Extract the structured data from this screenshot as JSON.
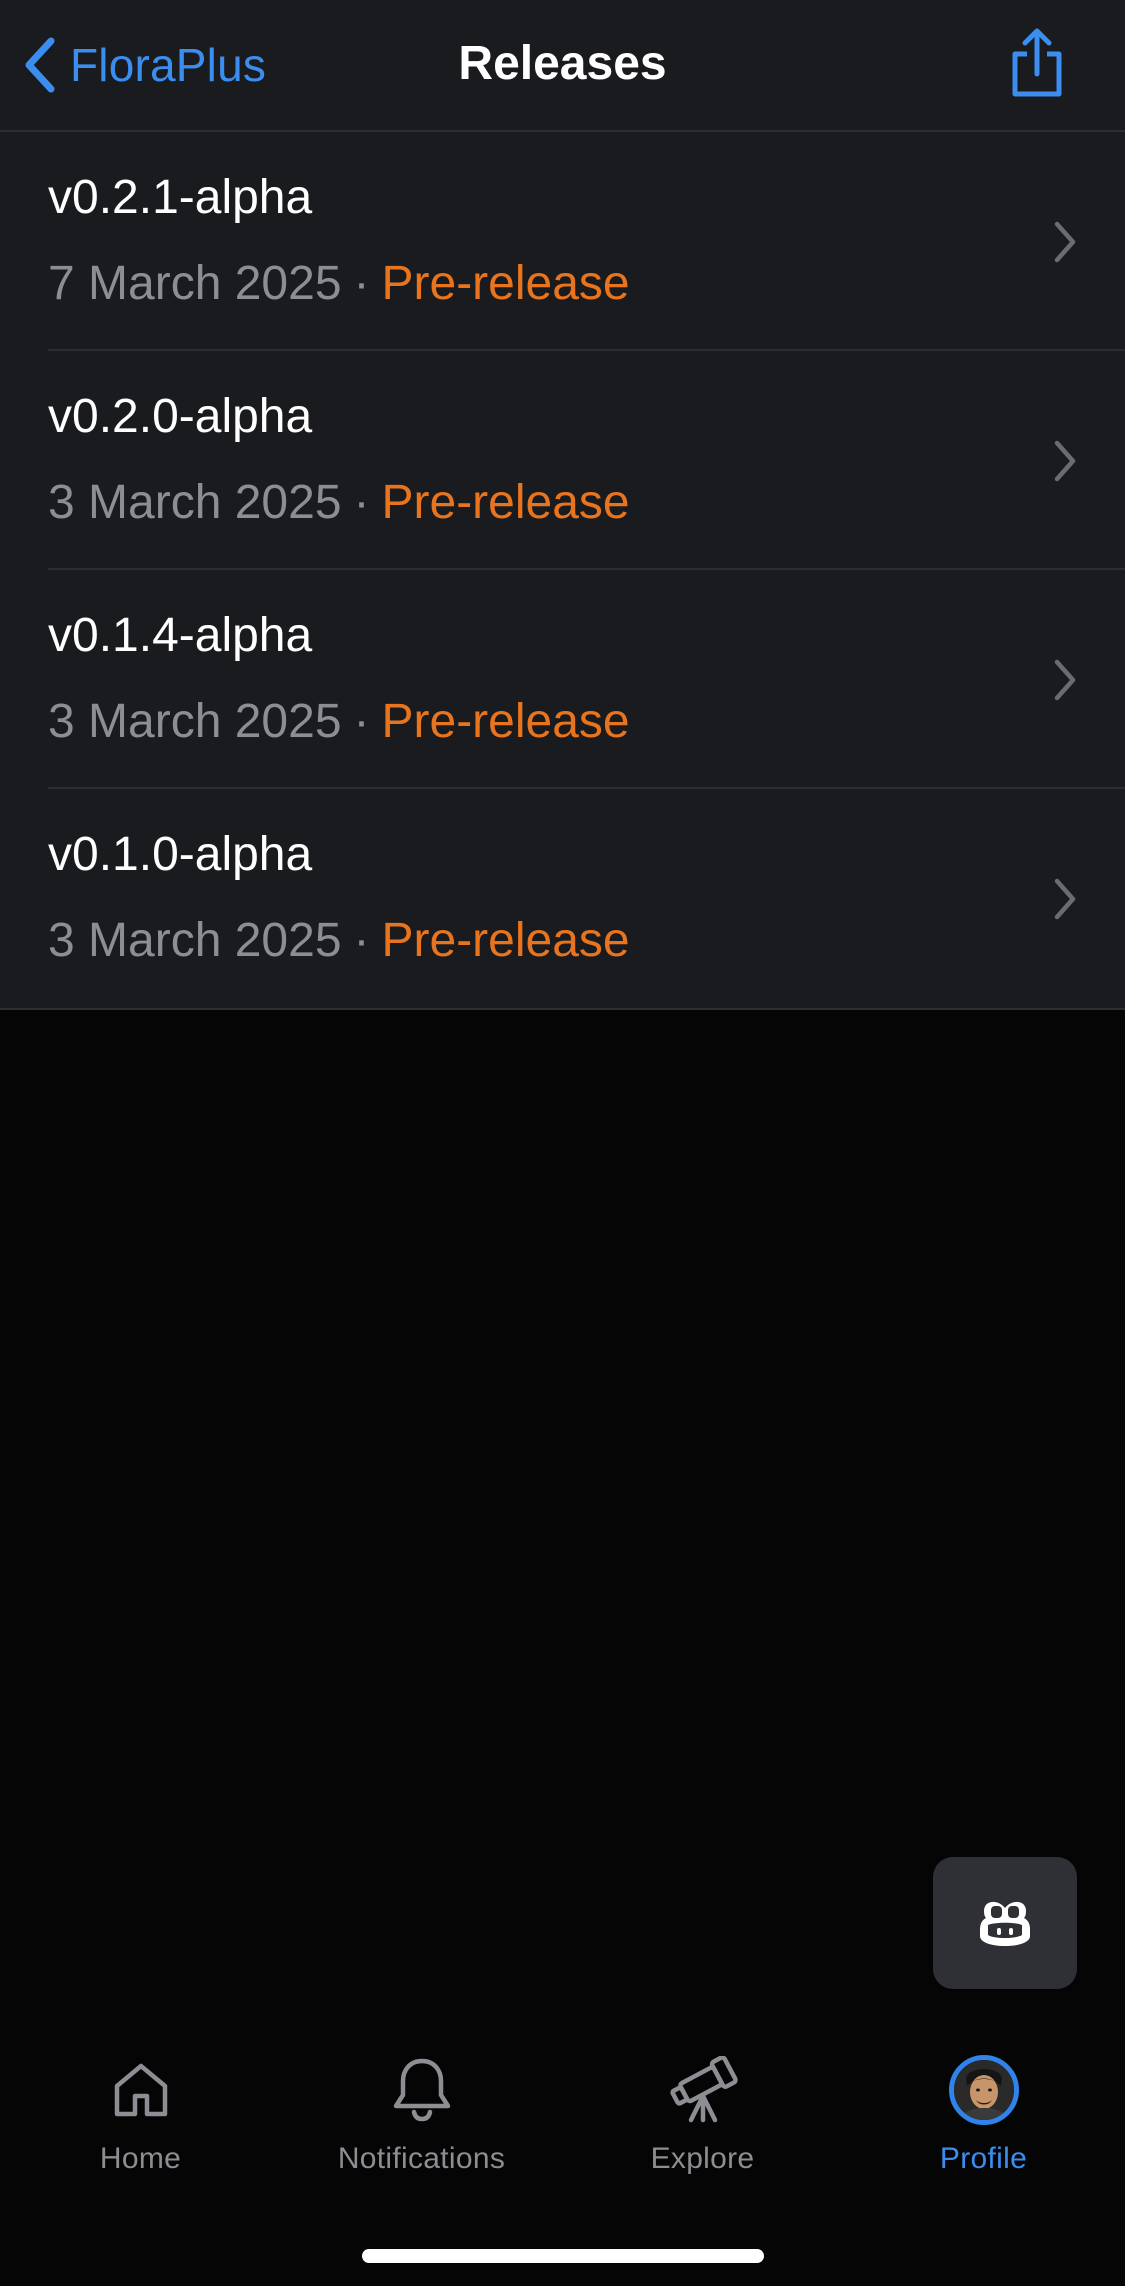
{
  "nav": {
    "back_label": "FloraPlus",
    "title": "Releases",
    "back_icon": "chevron-left-icon",
    "share_icon": "share-icon"
  },
  "releases": [
    {
      "name": "v0.2.1-alpha",
      "date": "7 March 2025",
      "badge": "Pre-release"
    },
    {
      "name": "v0.2.0-alpha",
      "date": "3 March 2025",
      "badge": "Pre-release"
    },
    {
      "name": "v0.1.4-alpha",
      "date": "3 March 2025",
      "badge": "Pre-release"
    },
    {
      "name": "v0.1.0-alpha",
      "date": "3 March 2025",
      "badge": "Pre-release"
    }
  ],
  "separator": "·",
  "tabs": {
    "home": {
      "label": "Home",
      "icon": "home-icon"
    },
    "notifications": {
      "label": "Notifications",
      "icon": "bell-icon"
    },
    "explore": {
      "label": "Explore",
      "icon": "telescope-icon"
    },
    "profile": {
      "label": "Profile",
      "icon": "avatar"
    }
  },
  "active_tab": "profile",
  "colors": {
    "accent": "#3b8ef0",
    "prerelease": "#e9741e",
    "secondary_text": "#8d8e93",
    "list_background": "#1a1b1f",
    "page_background": "#050505"
  }
}
